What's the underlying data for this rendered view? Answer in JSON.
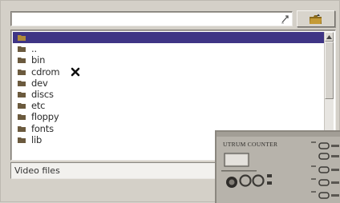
{
  "path_bar": {
    "value": ""
  },
  "file_list": {
    "items": [
      {
        "label": ""
      },
      {
        "label": ".."
      },
      {
        "label": "bin"
      },
      {
        "label": "cdrom"
      },
      {
        "label": "dev"
      },
      {
        "label": "discs"
      },
      {
        "label": "etc"
      },
      {
        "label": "floppy"
      },
      {
        "label": "fonts"
      },
      {
        "label": "lib"
      }
    ],
    "selected_index": 0
  },
  "filter": {
    "value": "Video files"
  },
  "device_photo": {
    "brand_text": "UTRUM COUNTER"
  },
  "colors": {
    "selection": "#3f3585",
    "window": "#d4d0c8"
  },
  "icons": {
    "folder": "folder-icon",
    "up_dir": "up-folder-icon",
    "history": "history-arrow-icon",
    "marker": "close-x-icon"
  }
}
